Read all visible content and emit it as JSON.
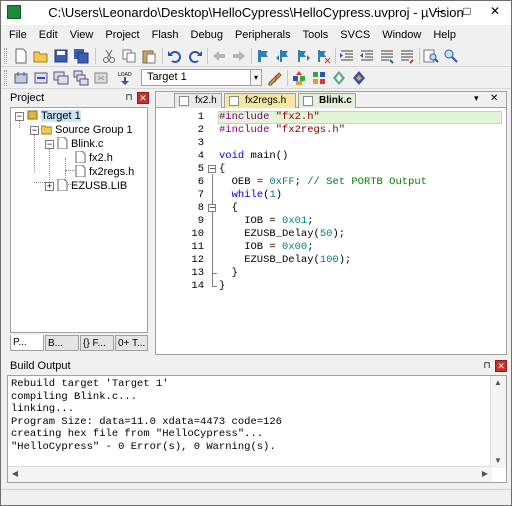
{
  "window": {
    "title": "C:\\Users\\Leonardo\\Desktop\\HelloCypress\\HelloCypress.uvproj - µVision",
    "minimize": "─",
    "maximize": "□",
    "close": "✕"
  },
  "menu": [
    "File",
    "Edit",
    "View",
    "Project",
    "Flash",
    "Debug",
    "Peripherals",
    "Tools",
    "SVCS",
    "Window",
    "Help"
  ],
  "toolbar": {
    "target_select": "Target 1",
    "dropdown_glyph": "▾"
  },
  "project_panel": {
    "title": "Project",
    "pin": "⊓",
    "close": "✕",
    "tree": {
      "target": "Target 1",
      "group": "Source Group 1",
      "blink": "Blink.c",
      "fx2h": "fx2.h",
      "fx2regs": "fx2regs.h",
      "lib": "EZUSB.LIB"
    },
    "tabs": [
      "P...",
      "B...",
      "{} F...",
      "0+ T..."
    ]
  },
  "editor": {
    "tabs": [
      "fx2.h",
      "fx2regs.h",
      "Blink.c"
    ],
    "active_tab": "Blink.c",
    "close": "✕",
    "menu": "▾",
    "line_numbers": [
      "1",
      "2",
      "3",
      "4",
      "5",
      "6",
      "7",
      "8",
      "9",
      "10",
      "11",
      "12",
      "13",
      "14"
    ],
    "lines": [
      [
        {
          "t": "#include ",
          "c": "pp"
        },
        {
          "t": "\"fx2.h\"",
          "c": "str"
        }
      ],
      [
        {
          "t": "#include ",
          "c": "pp"
        },
        {
          "t": "\"fx2regs.h\"",
          "c": "str"
        }
      ],
      [],
      [
        {
          "t": "void ",
          "c": "kw"
        },
        {
          "t": "main()",
          "c": ""
        }
      ],
      [
        {
          "t": "{",
          "c": ""
        }
      ],
      [
        {
          "t": "  OEB = ",
          "c": ""
        },
        {
          "t": "0xFF",
          "c": "num"
        },
        {
          "t": "; ",
          "c": ""
        },
        {
          "t": "// Set PORTB Output",
          "c": "cmt"
        }
      ],
      [
        {
          "t": "  ",
          "c": ""
        },
        {
          "t": "while",
          "c": "kw"
        },
        {
          "t": "(",
          "c": ""
        },
        {
          "t": "1",
          "c": "num"
        },
        {
          "t": ")",
          "c": ""
        }
      ],
      [
        {
          "t": "  {",
          "c": ""
        }
      ],
      [
        {
          "t": "    IOB = ",
          "c": ""
        },
        {
          "t": "0x01",
          "c": "num"
        },
        {
          "t": ";",
          "c": ""
        }
      ],
      [
        {
          "t": "    EZUSB_Delay(",
          "c": ""
        },
        {
          "t": "50",
          "c": "num"
        },
        {
          "t": ");",
          "c": ""
        }
      ],
      [
        {
          "t": "    IOB = ",
          "c": ""
        },
        {
          "t": "0x00",
          "c": "num"
        },
        {
          "t": ";",
          "c": ""
        }
      ],
      [
        {
          "t": "    EZUSB_Delay(",
          "c": ""
        },
        {
          "t": "100",
          "c": "num"
        },
        {
          "t": ");",
          "c": ""
        }
      ],
      [
        {
          "t": "  }",
          "c": ""
        }
      ],
      [
        {
          "t": "}",
          "c": ""
        }
      ]
    ]
  },
  "build": {
    "title": "Build Output",
    "pin": "⊓",
    "close": "✕",
    "lines": [
      "Rebuild target 'Target 1'",
      "compiling Blink.c...",
      "linking...",
      "Program Size: data=11.0 xdata=4473 code=126",
      "creating hex file from \"HelloCypress\"...",
      "\"HelloCypress\" - 0 Error(s), 0 Warning(s)."
    ]
  },
  "colors": {
    "current_line_bg": "#e2f5d6",
    "keyword": "#0000ff",
    "string": "#800000",
    "number": "#008080",
    "comment": "#008000",
    "preprocessor": "#800080"
  }
}
